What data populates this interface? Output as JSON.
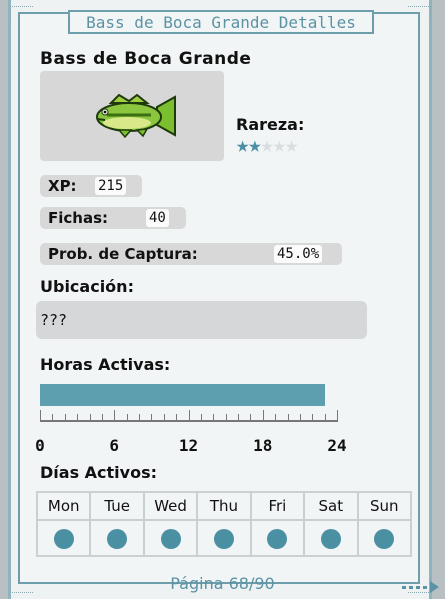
{
  "window": {
    "title": "Bass de Boca Grande Detalles"
  },
  "fish": {
    "name": "Bass de Boca Grande",
    "icon": "largemouth-bass-sprite"
  },
  "rarity": {
    "label": "Rareza:",
    "stars_filled": 2,
    "stars_total": 5
  },
  "stats": {
    "xp": {
      "label": "XP:",
      "value": "215"
    },
    "tokens": {
      "label": "Fichas:",
      "value": "40"
    },
    "catch_chance": {
      "label": "Prob. de Captura:",
      "value": "45.0%"
    }
  },
  "location": {
    "label": "Ubicación:",
    "value": "???"
  },
  "hours": {
    "label": "Horas Activas:",
    "active_from": 0,
    "active_to": 23,
    "ticks": [
      "0",
      "6",
      "12",
      "18",
      "24"
    ]
  },
  "days": {
    "label": "Días Activos:",
    "items": [
      {
        "name": "Mon",
        "active": true
      },
      {
        "name": "Tue",
        "active": true
      },
      {
        "name": "Wed",
        "active": true
      },
      {
        "name": "Thu",
        "active": true
      },
      {
        "name": "Fri",
        "active": true
      },
      {
        "name": "Sat",
        "active": true
      },
      {
        "name": "Sun",
        "active": true
      }
    ]
  },
  "pagination": {
    "text": "Página 68/90"
  },
  "colors": {
    "accent": "#4b8fa3",
    "bar": "#5d9eaf",
    "frame": "#6f9eab"
  }
}
